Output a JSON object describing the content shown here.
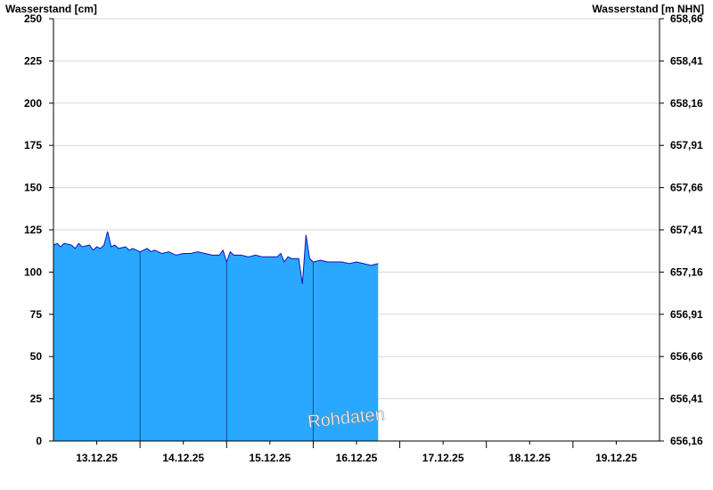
{
  "chart_data": {
    "type": "area",
    "ylabel_left": "Wasserstand [cm]",
    "ylabel_right": "Wasserstand [m NHN]",
    "ylim": [
      0,
      250
    ],
    "y2lim": [
      656.16,
      658.66
    ],
    "yticks": [
      0,
      25,
      50,
      75,
      100,
      125,
      150,
      175,
      200,
      225,
      250
    ],
    "yticks_right": [
      "656,16",
      "656,41",
      "656,66",
      "656,91",
      "657,16",
      "657,41",
      "657,66",
      "657,91",
      "658,16",
      "658,41",
      "658,66"
    ],
    "xlim": [
      "2025-12-12T12:00",
      "2025-12-19T12:00"
    ],
    "xtick_labels": [
      "13.12.25",
      "14.12.25",
      "15.12.25",
      "16.12.25",
      "17.12.25",
      "18.12.25",
      "19.12.25"
    ],
    "grid": true,
    "watermark": "Rohdaten",
    "series": [
      {
        "color": "#2aa8ff",
        "line_color": "#1010c0",
        "points": [
          [
            "2025-12-12T12:00",
            116
          ],
          [
            "2025-12-12T13:00",
            117
          ],
          [
            "2025-12-12T14:00",
            115
          ],
          [
            "2025-12-12T15:00",
            117
          ],
          [
            "2025-12-12T17:00",
            116
          ],
          [
            "2025-12-12T18:00",
            114
          ],
          [
            "2025-12-12T19:00",
            117
          ],
          [
            "2025-12-12T20:00",
            115
          ],
          [
            "2025-12-12T22:00",
            116
          ],
          [
            "2025-12-12T23:00",
            113
          ],
          [
            "2025-12-13T00:00",
            115
          ],
          [
            "2025-12-13T01:00",
            114
          ],
          [
            "2025-12-13T02:00",
            116
          ],
          [
            "2025-12-13T03:00",
            124
          ],
          [
            "2025-12-13T04:00",
            115
          ],
          [
            "2025-12-13T05:00",
            116
          ],
          [
            "2025-12-13T06:00",
            114
          ],
          [
            "2025-12-13T08:00",
            115
          ],
          [
            "2025-12-13T09:00",
            113
          ],
          [
            "2025-12-13T10:00",
            114
          ],
          [
            "2025-12-13T12:00",
            112
          ],
          [
            "2025-12-13T14:00",
            114
          ],
          [
            "2025-12-13T15:00",
            112
          ],
          [
            "2025-12-13T16:00",
            113
          ],
          [
            "2025-12-13T18:00",
            111
          ],
          [
            "2025-12-13T20:00",
            112
          ],
          [
            "2025-12-13T22:00",
            110
          ],
          [
            "2025-12-14T00:00",
            111
          ],
          [
            "2025-12-14T02:00",
            111
          ],
          [
            "2025-12-14T04:00",
            112
          ],
          [
            "2025-12-14T06:00",
            111
          ],
          [
            "2025-12-14T08:00",
            110
          ],
          [
            "2025-12-14T10:00",
            110
          ],
          [
            "2025-12-14T11:00",
            113
          ],
          [
            "2025-12-14T12:00",
            106
          ],
          [
            "2025-12-14T13:00",
            112
          ],
          [
            "2025-12-14T14:00",
            110
          ],
          [
            "2025-12-14T16:00",
            110
          ],
          [
            "2025-12-14T18:00",
            109
          ],
          [
            "2025-12-14T20:00",
            110
          ],
          [
            "2025-12-14T22:00",
            109
          ],
          [
            "2025-12-15T00:00",
            109
          ],
          [
            "2025-12-15T02:00",
            109
          ],
          [
            "2025-12-15T03:00",
            111
          ],
          [
            "2025-12-15T04:00",
            106
          ],
          [
            "2025-12-15T05:00",
            109
          ],
          [
            "2025-12-15T06:00",
            108
          ],
          [
            "2025-12-15T08:00",
            108
          ],
          [
            "2025-12-15T09:00",
            93
          ],
          [
            "2025-12-15T10:00",
            122
          ],
          [
            "2025-12-15T11:00",
            108
          ],
          [
            "2025-12-15T12:00",
            106
          ],
          [
            "2025-12-15T14:00",
            107
          ],
          [
            "2025-12-15T16:00",
            106
          ],
          [
            "2025-12-15T18:00",
            106
          ],
          [
            "2025-12-15T20:00",
            106
          ],
          [
            "2025-12-15T22:00",
            105
          ],
          [
            "2025-12-16T00:00",
            106
          ],
          [
            "2025-12-16T02:00",
            105
          ],
          [
            "2025-12-16T04:00",
            104
          ],
          [
            "2025-12-16T06:00",
            105
          ]
        ]
      }
    ]
  }
}
